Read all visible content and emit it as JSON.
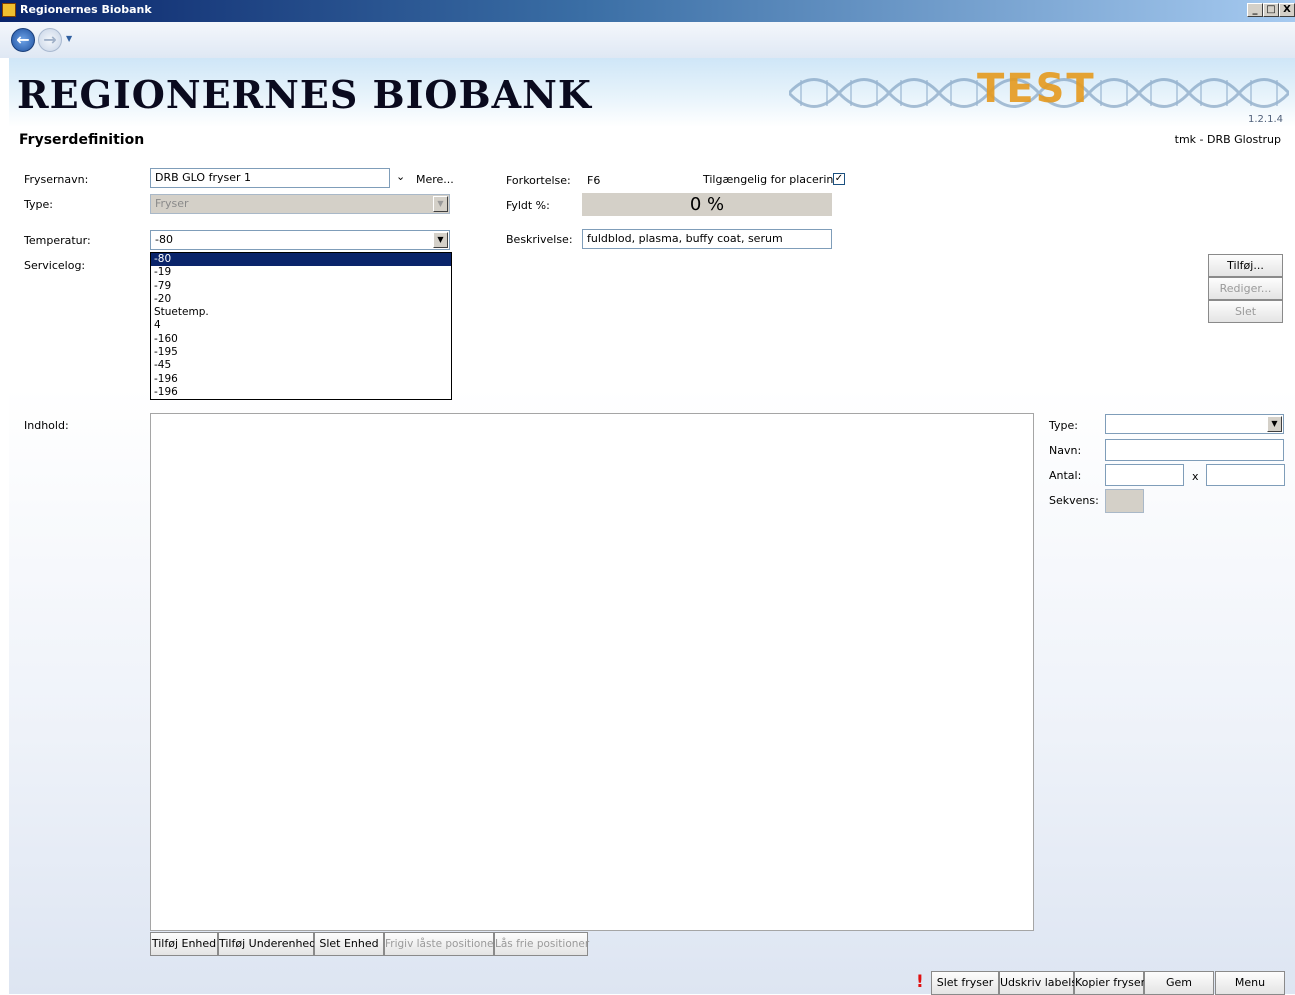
{
  "window": {
    "title": "Regionernes Biobank",
    "controls": [
      "_",
      "□",
      "X"
    ]
  },
  "banner": {
    "brand": "REGIONERNES BIOBANK",
    "watermark": "TEST",
    "version": "1.2.1.4"
  },
  "page": {
    "title": "Fryserdefinition",
    "user": "tmk - DRB Glostrup"
  },
  "form": {
    "frysernavn_label": "Frysernavn:",
    "frysernavn_value": "DRB GLO fryser 1",
    "mere_label": "Mere...",
    "type_label": "Type:",
    "type_value": "Fryser",
    "temperatur_label": "Temperatur:",
    "temperatur_value": "-80",
    "servicelog_label": "Servicelog:",
    "forkortelse_label": "Forkortelse:",
    "forkortelse_value": "F6",
    "tilgaengelig_label": "Tilgængelig for placering:",
    "tilgaengelig_checked": true,
    "fyldt_label": "Fyldt %:",
    "fyldt_value": "0 %",
    "beskrivelse_label": "Beskrivelse:",
    "beskrivelse_value": "fuldblod, plasma, buffy coat, serum"
  },
  "temperature_options": [
    "-80",
    "-19",
    "-79",
    "-20",
    "Stuetemp.",
    "4",
    "-160",
    "-195",
    "-45",
    "-196",
    "-196"
  ],
  "temperature_selected_index": 0,
  "servicelog_buttons": {
    "add": "Tilføj...",
    "edit": "Rediger...",
    "delete": "Slet"
  },
  "content": {
    "label": "Indhold:",
    "side": {
      "type_label": "Type:",
      "navn_label": "Navn:",
      "antal_label": "Antal:",
      "x_label": "x",
      "sekvens_label": "Sekvens:"
    },
    "buttons": {
      "add_unit": "Tilføj Enhed",
      "add_subunit": "Tilføj Underenhed",
      "delete_unit": "Slet Enhed",
      "release_locked": "Frigiv låste positioner",
      "lock_free": "Lås frie positioner"
    }
  },
  "footer": {
    "warning": "!",
    "delete_freezer": "Slet fryser",
    "print_labels": "Udskriv labels",
    "copy_freezer": "Kopier fryser",
    "save": "Gem",
    "menu": "Menu"
  },
  "colors": {
    "titlebar": "#0a246a",
    "selection": "#0a246a",
    "brand_text": "#0a0a1e",
    "test_watermark": "#e69a1e",
    "warning": "#e01010"
  }
}
